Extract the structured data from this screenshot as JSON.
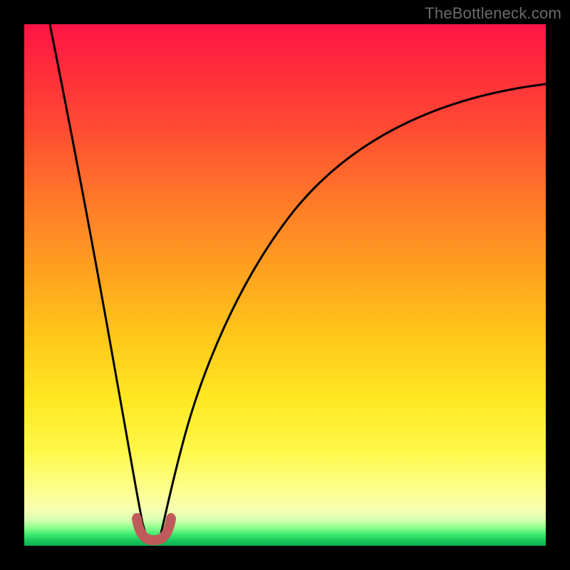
{
  "watermark": {
    "text": "TheBottleneck.com"
  },
  "chart_data": {
    "type": "line",
    "title": "",
    "xlabel": "",
    "ylabel": "",
    "xlim": [
      0,
      100
    ],
    "ylim": [
      0,
      100
    ],
    "grid": false,
    "legend": false,
    "series": [
      {
        "name": "curve-left",
        "x": [
          5,
          7,
          9,
          11,
          13,
          15,
          17,
          19,
          20,
          21,
          21.8
        ],
        "values": [
          100,
          88,
          76,
          64,
          52,
          40,
          28,
          16,
          10,
          5,
          2
        ]
      },
      {
        "name": "curve-right",
        "x": [
          25.2,
          26,
          27,
          29,
          31,
          34,
          38,
          43,
          49,
          56,
          64,
          73,
          82,
          91,
          100
        ],
        "values": [
          2,
          5,
          10,
          18,
          26,
          36,
          46,
          55,
          63,
          70,
          76,
          80.5,
          84,
          86.5,
          88.5
        ]
      },
      {
        "name": "valley-marker",
        "x": [
          20.5,
          21.2,
          22.0,
          23.5,
          25.0,
          25.8,
          26.5
        ],
        "values": [
          5,
          3,
          2,
          1.5,
          2,
          3,
          5
        ]
      }
    ],
    "annotations": [
      {
        "text": "TheBottleneck.com",
        "position": "top-right"
      }
    ],
    "colors": {
      "curve": "#000000",
      "valley_marker": "#c05a5a",
      "gradient_top": "#ff1446",
      "gradient_mid": "#ffe822",
      "gradient_bottom": "#19c85c"
    }
  }
}
